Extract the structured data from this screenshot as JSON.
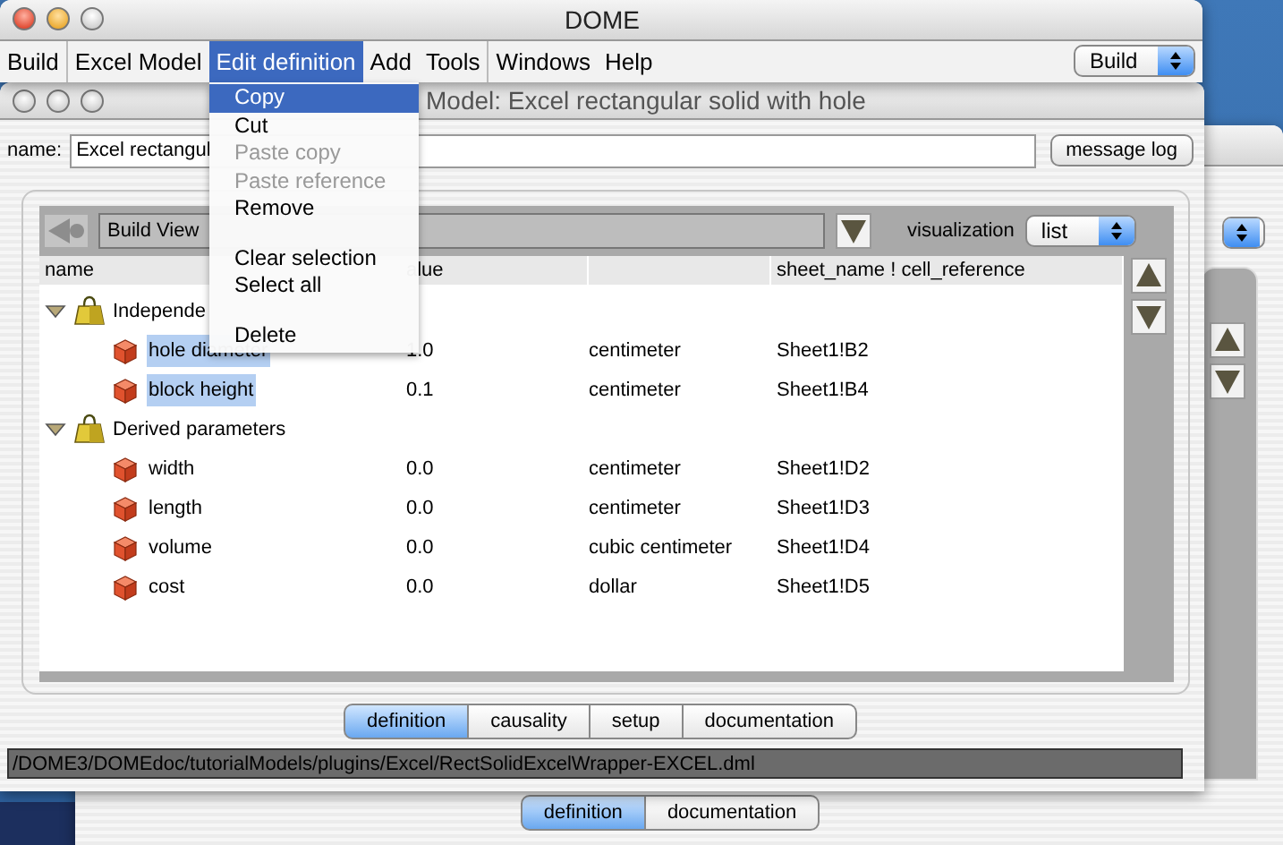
{
  "menubar_window": {
    "title": "DOME",
    "menu_groups": [
      {
        "items": [
          {
            "label": "Build",
            "selected": false
          }
        ]
      },
      {
        "items": [
          {
            "label": "Excel Model",
            "selected": false
          },
          {
            "label": "Edit definition",
            "selected": true
          },
          {
            "label": "Add",
            "selected": false
          },
          {
            "label": "Tools",
            "selected": false
          }
        ]
      },
      {
        "items": [
          {
            "label": "Windows",
            "selected": false
          },
          {
            "label": "Help",
            "selected": false
          }
        ]
      }
    ],
    "mode_select": "Build"
  },
  "model_window": {
    "title": "Model: Excel rectangular solid with hole",
    "name_label": "name:",
    "name_value": "Excel rectangul",
    "message_log_button": "message log",
    "view_select": "Build View",
    "visualization_label": "visualization",
    "visualization_select": "list",
    "table": {
      "columns": [
        "name",
        "alue",
        "sheet_name ! cell_reference"
      ],
      "groups": [
        {
          "name": "Independe",
          "expanded": true,
          "children": [
            {
              "name": "hole diameter",
              "value": "1.0",
              "unit": "centimeter",
              "cell": "Sheet1!B2",
              "selected": true
            },
            {
              "name": "block height",
              "value": "0.1",
              "unit": "centimeter",
              "cell": "Sheet1!B4",
              "selected": true
            }
          ]
        },
        {
          "name": "Derived parameters",
          "expanded": true,
          "children": [
            {
              "name": "width",
              "value": "0.0",
              "unit": "centimeter",
              "cell": "Sheet1!D2",
              "selected": false
            },
            {
              "name": "length",
              "value": "0.0",
              "unit": "centimeter",
              "cell": "Sheet1!D3",
              "selected": false
            },
            {
              "name": "volume",
              "value": "0.0",
              "unit": "cubic centimeter",
              "cell": "Sheet1!D4",
              "selected": false
            },
            {
              "name": "cost",
              "value": "0.0",
              "unit": "dollar",
              "cell": "Sheet1!D5",
              "selected": false
            }
          ]
        }
      ]
    },
    "tabs": [
      {
        "label": "definition",
        "selected": true
      },
      {
        "label": "causality",
        "selected": false
      },
      {
        "label": "setup",
        "selected": false
      },
      {
        "label": "documentation",
        "selected": false
      }
    ],
    "status_path": "/DOME3/DOMEdoc/tutorialModels/plugins/Excel/RectSolidExcelWrapper-EXCEL.dml"
  },
  "background_window": {
    "tabs": [
      {
        "label": "definition",
        "selected": true
      },
      {
        "label": "documentation",
        "selected": false
      }
    ]
  },
  "edit_menu": {
    "items": [
      {
        "kind": "item",
        "label": "Copy",
        "selected": true,
        "disabled": false
      },
      {
        "kind": "item",
        "label": "Cut",
        "selected": false,
        "disabled": false
      },
      {
        "kind": "item",
        "label": "Paste copy",
        "selected": false,
        "disabled": true
      },
      {
        "kind": "item",
        "label": "Paste reference",
        "selected": false,
        "disabled": true
      },
      {
        "kind": "item",
        "label": "Remove",
        "selected": false,
        "disabled": false
      },
      {
        "kind": "gap"
      },
      {
        "kind": "item",
        "label": "Clear selection",
        "selected": false,
        "disabled": false
      },
      {
        "kind": "item",
        "label": "Select all",
        "selected": false,
        "disabled": false
      },
      {
        "kind": "gap"
      },
      {
        "kind": "item",
        "label": "Delete",
        "selected": false,
        "disabled": false
      }
    ]
  }
}
